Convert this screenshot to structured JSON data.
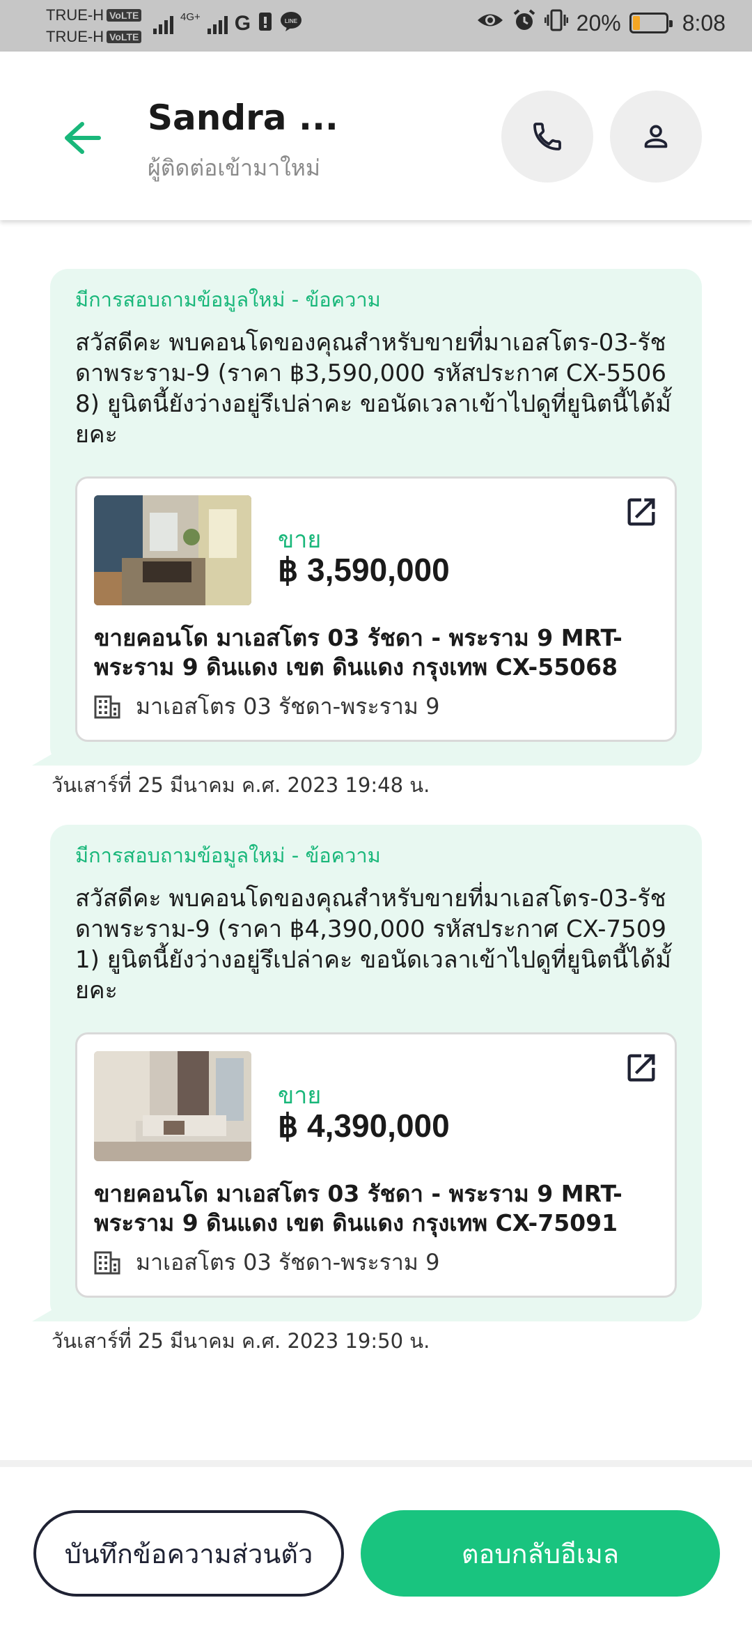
{
  "status_bar": {
    "carrier_1": "TRUE-H",
    "carrier_2": "TRUE-H",
    "volte": "VoLTE",
    "network": "4G+",
    "g_icon": "G",
    "battery_percent": "20%",
    "battery_level": 0.2,
    "time": "8:08",
    "icons": [
      "signal-icon",
      "g-icon",
      "sim-icon",
      "line-icon",
      "eye-icon",
      "alarm-icon",
      "vibrate-icon",
      "battery-icon"
    ]
  },
  "header": {
    "contact_name": "Sandra ...",
    "contact_subtitle": "ผู้ติดต่อเข้ามาใหม่",
    "accent_color": "#19b77a"
  },
  "messages": [
    {
      "title": "มีการสอบถามข้อมูลใหม่ - ข้อความ",
      "text": "สวัสดีคะ พบคอนโดของคุณสำหรับขายที่มาเอสโตร-03-รัชดาพระราม-9 (ราคา ฿3,590,000 รหัสประกาศ CX-55068) ยูนิตนี้ยังว่างอยู่รึเปล่าคะ ขอนัดเวลาเข้าไปดูที่ยูนิตนี้ได้มั้ยคะ",
      "listing": {
        "type": "ขาย",
        "price": "฿ 3,590,000",
        "title": "ขายคอนโด  มาเอสโตร 03 รัชดา - พระราม 9 MRT-พระราม 9 ดินแดง เขต ดินแดง กรุงเทพ CX-55068",
        "project": "มาเอสโตร 03 รัชดา-พระราม 9"
      },
      "timestamp": "วันเสาร์ที่ 25 มีนาคม ค.ศ. 2023 19:48 น."
    },
    {
      "title": "มีการสอบถามข้อมูลใหม่ - ข้อความ",
      "text": "สวัสดีคะ พบคอนโดของคุณสำหรับขายที่มาเอสโตร-03-รัชดาพระราม-9 (ราคา ฿4,390,000 รหัสประกาศ CX-75091) ยูนิตนี้ยังว่างอยู่รึเปล่าคะ ขอนัดเวลาเข้าไปดูที่ยูนิตนี้ได้มั้ยคะ",
      "listing": {
        "type": "ขาย",
        "price": "฿ 4,390,000",
        "title": "ขายคอนโด  มาเอสโตร 03 รัชดา - พระราม 9 MRT-พระราม 9 ดินแดง เขต ดินแดง กรุงเทพ CX-75091",
        "project": "มาเอสโตร 03 รัชดา-พระราม 9"
      },
      "timestamp": "วันเสาร์ที่ 25 มีนาคม ค.ศ. 2023 19:50 น."
    }
  ],
  "actions": {
    "private_note": "บันทึกข้อความส่วนตัว",
    "reply_email": "ตอบกลับอีเมล"
  }
}
